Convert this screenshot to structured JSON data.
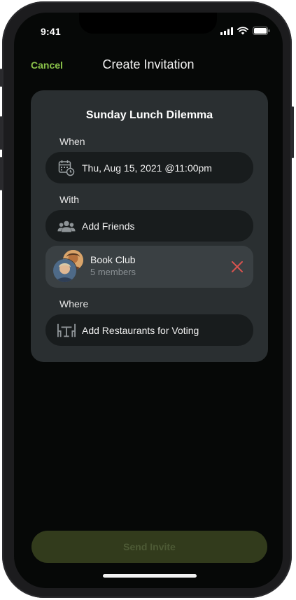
{
  "status_bar": {
    "time": "9:41"
  },
  "nav": {
    "cancel_label": "Cancel",
    "title": "Create Invitation"
  },
  "card": {
    "title": "Sunday Lunch Dilemma",
    "when": {
      "label": "When",
      "value": "Thu, Aug 15, 2021 @11:00pm",
      "icon": "calendar-clock-icon"
    },
    "with": {
      "label": "With",
      "add_label": "Add Friends",
      "icon": "people-icon"
    },
    "group": {
      "name": "Book Club",
      "members": "5 members",
      "remove_icon": "close-icon"
    },
    "where": {
      "label": "Where",
      "add_label": "Add Restaurants for Voting",
      "icon": "restaurant-table-icon"
    }
  },
  "send_button": {
    "label": "Send Invite"
  },
  "colors": {
    "accent": "#8bc34a",
    "remove": "#d9534f",
    "send_disabled_bg": "#323b1c"
  }
}
